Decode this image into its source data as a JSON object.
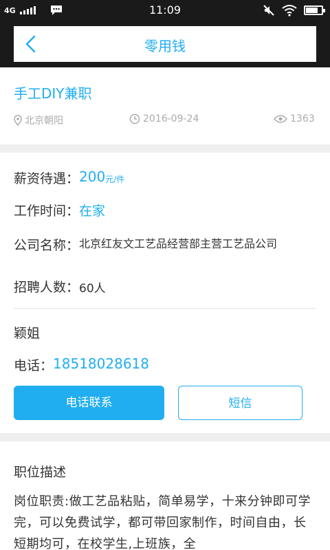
{
  "status_bar": {
    "network": "4G",
    "time": "11:09"
  },
  "nav": {
    "title": "零用钱"
  },
  "job": {
    "title": "手工DIY兼职",
    "location": "北京朝阳",
    "date": "2016-09-24",
    "views": "1363"
  },
  "details": {
    "salary_label": "薪资待遇：",
    "salary_value": "200",
    "salary_unit": "元/件",
    "worktime_label": "工作时间：",
    "worktime_value": "在家",
    "company_label": "公司名称：",
    "company_value": "北京红友文工艺品经营部主营工艺品公司",
    "headcount_label": "招聘人数：",
    "headcount_value": "60人",
    "contact_name": "颖姐",
    "phone_label": "电话：",
    "phone_value": "18518028618",
    "call_button": "电话联系",
    "sms_button": "短信"
  },
  "description": {
    "title": "职位描述",
    "body": "岗位职责:做工艺品粘贴，简单易学，十来分钟即可学完，可以免费试学，都可带回家制作，时间自由，长短期均可，在校学生,上班族，全"
  },
  "colors": {
    "accent": "#20aef0",
    "background": "#efefef",
    "statusbar": "#1a1a1a"
  }
}
